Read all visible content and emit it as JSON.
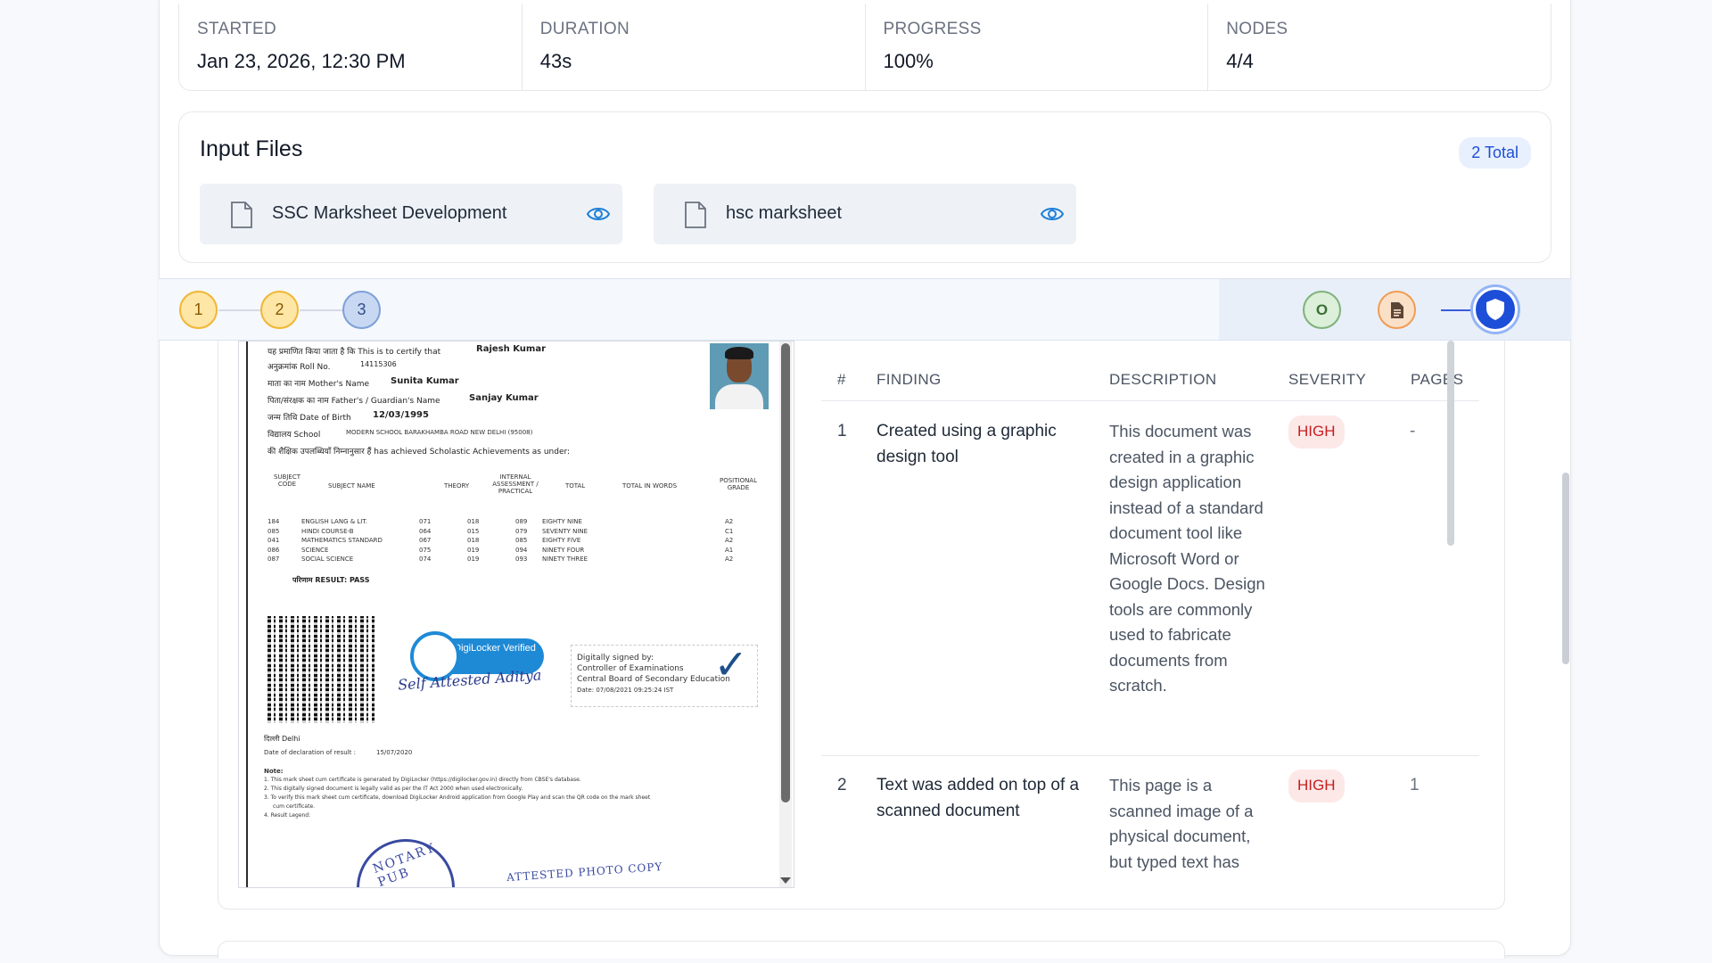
{
  "stats": [
    {
      "label": "STARTED",
      "value": "Jan 23, 2026, 12:30 PM"
    },
    {
      "label": "DURATION",
      "value": "43s"
    },
    {
      "label": "PROGRESS",
      "value": "100%"
    },
    {
      "label": "NODES",
      "value": "4/4"
    }
  ],
  "input_files": {
    "title": "Input Files",
    "total_badge": "2 Total",
    "files": [
      {
        "name": "SSC Marksheet Development",
        "icon": "file-icon",
        "action_icon": "eye-icon"
      },
      {
        "name": "hsc marksheet",
        "icon": "file-icon",
        "action_icon": "eye-icon"
      }
    ]
  },
  "steps": [
    "1",
    "2",
    "3"
  ],
  "nodes": [
    {
      "label": "O",
      "icon": "o-icon"
    },
    {
      "icon": "document-icon"
    },
    {
      "icon": "shield-icon"
    }
  ],
  "document": {
    "lines": [
      "यह प्रमाणित किया जाता है कि This is to certify that",
      "Rajesh Kumar",
      "अनुक्रमांक Roll No.",
      "14115306",
      "माता का नाम Mother's Name",
      "Sunita Kumar",
      "पिता/संरक्षक का नाम Father's / Guardian's Name",
      "Sanjay Kumar",
      "जन्म तिथि Date of Birth",
      "12/03/1995",
      "विद्यालय School",
      "MODERN SCHOOL BARAKHAMBA ROAD NEW DELHI (95008)",
      "की शैक्षिक उपलब्धियाँ निम्नानुसार हैं has achieved Scholastic Achievements as under:"
    ],
    "table_headers": [
      "SUBJECT CODE",
      "SUBJECT NAME",
      "THEORY",
      "INTERNAL ASSESSMENT / PRACTICAL",
      "TOTAL",
      "TOTAL IN WORDS",
      "POSITIONAL GRADE"
    ],
    "subjects": [
      [
        "184",
        "ENGLISH LANG & LIT.",
        "071",
        "018",
        "089",
        "EIGHTY NINE",
        "A2"
      ],
      [
        "085",
        "HINDI COURSE-B",
        "064",
        "015",
        "079",
        "SEVENTY NINE",
        "C1"
      ],
      [
        "041",
        "MATHEMATICS STANDARD",
        "067",
        "018",
        "085",
        "EIGHTY FIVE",
        "A2"
      ],
      [
        "086",
        "SCIENCE",
        "075",
        "019",
        "094",
        "NINETY FOUR",
        "A1"
      ],
      [
        "087",
        "SOCIAL SCIENCE",
        "074",
        "019",
        "093",
        "NINETY THREE",
        "A2"
      ]
    ],
    "result": "परिणाम RESULT: PASS",
    "digilocker": "DigiLocker Verified",
    "signature": [
      "Digitally signed by:",
      "Controller of Examinations",
      "Central Board of Secondary Education",
      "Date: 07/08/2021 09:25:24 IST"
    ],
    "handwriting": "Self Attested Aditya",
    "place": "दिल्ली Delhi",
    "declaration": "Date of declaration of result :",
    "declaration_date": "15/07/2020",
    "notes": [
      "Note:",
      "1. This mark sheet cum certificate is generated by DigiLocker (https://digilocker.gov.in) directly from CBSE's database.",
      "2. This digitally signed document is legally valid as per the IT Act 2000 when used electronically.",
      "3. To verify this mark sheet cum certificate, download DigiLocker Android application from Google Play and scan the QR code on the mark sheet",
      "cum certificate.",
      "4. Result Legend:"
    ],
    "stamp": "NOTARY PUB",
    "copy_stamp": "ATTESTED PHOTO COPY"
  },
  "findings": {
    "headers": [
      "#",
      "FINDING",
      "DESCRIPTION",
      "SEVERITY",
      "PAGES"
    ],
    "rows": [
      {
        "num": "1",
        "finding": "Created using a graphic design tool",
        "description": "This document was created in a graphic design application instead of a standard document tool like Microsoft Word or Google Docs. Design tools are commonly used to fabricate documents from scratch.",
        "severity": "HIGH",
        "pages": "-"
      },
      {
        "num": "2",
        "finding": "Text was added on top of a scanned document",
        "description": "This page is a scanned image of a physical document, but typed text has",
        "severity": "HIGH",
        "pages": "1"
      }
    ]
  },
  "colors": {
    "accent": "#1d4ed8",
    "severity_high": "#c81e1e",
    "step_pending": "#f2b634"
  }
}
